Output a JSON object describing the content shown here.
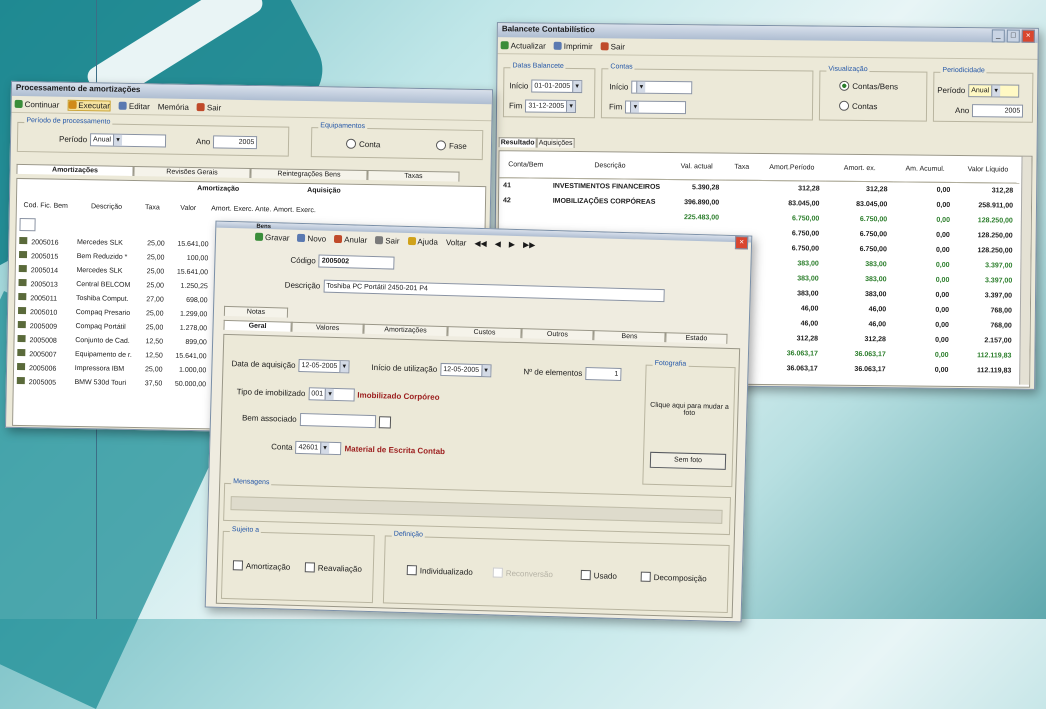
{
  "window_amortizations": {
    "title": "Processamento de amortizações",
    "toolbar": [
      "Continuar",
      "Executar",
      "Editar",
      "Memória",
      "Sair"
    ],
    "period_group": "Período de processamento",
    "period_label": "Período",
    "period_value": "Anual",
    "year_label": "Ano",
    "year_value": "2005",
    "equipment_group": "Equipamentos",
    "radio1": "Conta",
    "radio2": "Fase",
    "tabs": [
      "Amortizações",
      "Revisões Gerais",
      "Reintegrações Bens",
      "Taxas"
    ],
    "group_headers": [
      "Amortização",
      "Aquisição"
    ],
    "columns": [
      "Cod. Fic. Bem",
      "Descrição",
      "Taxa",
      "Valor",
      "Amort. Exerc. Ante.",
      "Amort. Exerc."
    ],
    "rows": [
      [
        "2005016",
        "Mercedes SLK",
        "25,00",
        "15.641,00",
        "3.910"
      ],
      [
        "2005015",
        "Bem Reduzido *",
        "25,00",
        "100,00",
        ""
      ],
      [
        "2005014",
        "Mercedes SLK",
        "25,00",
        "15.641,00",
        "3.9"
      ],
      [
        "2005013",
        "Central BELCOM",
        "25,00",
        "1.250,25",
        ""
      ],
      [
        "2005011",
        "Toshiba Comput.",
        "27,00",
        "698,00",
        ""
      ],
      [
        "2005010",
        "Compaq Presario",
        "25,00",
        "1.299,00",
        ""
      ],
      [
        "2005009",
        "Compaq Portátil",
        "25,00",
        "1.278,00",
        ""
      ],
      [
        "2005008",
        "Conjunto de Cad.",
        "12,50",
        "899,00",
        ""
      ],
      [
        "2005007",
        "Equipamento de r.",
        "12,50",
        "15.641,00",
        ""
      ],
      [
        "2005006",
        "Impressora IBM",
        "25,00",
        "1.000,00",
        ""
      ],
      [
        "2005005",
        "BMW 530d Touri",
        "37,50",
        "50.000,00",
        ""
      ]
    ]
  },
  "window_accounting": {
    "title": "Balancete Contabilístico",
    "toolbar": [
      "Actualizar",
      "Imprimir",
      "Sair"
    ],
    "dates_group": "Datas Balancete",
    "from_label": "Início",
    "from_value": "01-01-2005",
    "to_label": "Fim",
    "to_value": "31-12-2005",
    "accounts_group": "Contas",
    "acc_from_label": "Início",
    "acc_to_label": "Fim",
    "view_group": "Visualização",
    "radio_accounts_assets": "Contas/Bens",
    "radio_accounts": "Contas",
    "period_group": "Periodicidade",
    "period_label": "Período",
    "period_value": "Anual",
    "year_label": "Ano",
    "year_value": "2005",
    "tabs": [
      "Resultado",
      "Aquisições"
    ],
    "columns": [
      "Conta/Bem",
      "Descrição",
      "Val. actual",
      "Taxa",
      "Amort.Período",
      "Amort. ex.",
      "Am. Acumul.",
      "Valor Líquido"
    ],
    "rows": [
      {
        "conta": "41",
        "descricao": "INVESTIMENTOS FINANCEIROS",
        "val": "5.390,28",
        "taxa": "",
        "ap": "312,28",
        "ae": "312,28",
        "aa": "0,00",
        "vl": "312,28",
        "green": false
      },
      {
        "conta": "42",
        "descricao": "IMOBILIZAÇÕES CORPÓREAS",
        "val": "396.890,00",
        "taxa": "",
        "ap": "83.045,00",
        "ae": "83.045,00",
        "aa": "0,00",
        "vl": "258.911,00",
        "green": false
      },
      {
        "conta": "",
        "descricao": "",
        "val": "225.483,00",
        "taxa": "",
        "ap": "6.750,00",
        "ae": "6.750,00",
        "aa": "0,00",
        "vl": "128.250,00",
        "green": true
      },
      {
        "conta": "",
        "descricao": "",
        "val": "",
        "taxa": "",
        "ap": "6.750,00",
        "ae": "6.750,00",
        "aa": "0,00",
        "vl": "128.250,00",
        "green": false
      },
      {
        "conta": "",
        "descricao": "",
        "val": "",
        "taxa": "6,00",
        "ap": "6.750,00",
        "ae": "6.750,00",
        "aa": "0,00",
        "vl": "128.250,00",
        "green": false
      },
      {
        "conta": "",
        "descricao": "",
        "val": "",
        "taxa": "",
        "ap": "383,00",
        "ae": "383,00",
        "aa": "0,00",
        "vl": "3.397,00",
        "green": true
      },
      {
        "conta": "",
        "descricao": "",
        "val": "",
        "taxa": "",
        "ap": "383,00",
        "ae": "383,00",
        "aa": "0,00",
        "vl": "3.397,00",
        "green": true
      },
      {
        "conta": "",
        "descricao": "",
        "val": "",
        "taxa": "",
        "ap": "383,00",
        "ae": "383,00",
        "aa": "0,00",
        "vl": "3.397,00",
        "green": false
      },
      {
        "conta": "",
        "descricao": "",
        "val": "",
        "taxa": "",
        "ap": "46,00",
        "ae": "46,00",
        "aa": "0,00",
        "vl": "768,00",
        "green": false
      },
      {
        "conta": "",
        "descricao": "",
        "val": "",
        "taxa": "",
        "ap": "46,00",
        "ae": "46,00",
        "aa": "0,00",
        "vl": "768,00",
        "green": false
      },
      {
        "conta": "",
        "descricao": "",
        "val": "",
        "taxa": "",
        "ap": "312,28",
        "ae": "312,28",
        "aa": "0,00",
        "vl": "2.157,00",
        "green": false
      },
      {
        "conta": "",
        "descricao": "",
        "val": "",
        "taxa": "",
        "ap": "36.063,17",
        "ae": "36.063,17",
        "aa": "0,00",
        "vl": "112.119,83",
        "green": true
      },
      {
        "conta": "",
        "descricao": "",
        "val": "",
        "taxa": "",
        "ap": "36.063,17",
        "ae": "36.063,17",
        "aa": "0,00",
        "vl": "112.119,83",
        "green": false
      }
    ]
  },
  "window_asset": {
    "title": "Bens",
    "toolbar": [
      "Gravar",
      "Novo",
      "Anular",
      "Sair",
      "Ajuda",
      "Voltar"
    ],
    "code_label": "Código",
    "code_value": "2005002",
    "desc_label": "Descrição",
    "desc_value": "Toshiba PC Portátil 2450-201 P4",
    "tab_top": "Notas",
    "tabs": [
      "Geral",
      "Valores",
      "Amortizações",
      "Custos",
      "Outros",
      "Bens",
      "Estado"
    ],
    "acq_date_label": "Data de aquisição",
    "acq_date_value": "12-05-2005",
    "use_date_label": "Início de utilização",
    "use_date_value": "12-05-2005",
    "elements_label": "Nº de elementos",
    "elements_value": "1",
    "type_label": "Tipo de imobilizado",
    "type_code": "001",
    "type_desc": "Imobilizado Corpóreo",
    "assoc_label": "Bem associado",
    "account_label": "Conta",
    "account_code": "42601",
    "account_desc": "Material de Escrita Contab",
    "photo_group": "Fotografia",
    "photo_hint": "Clique aqui para mudar a foto",
    "photo_button": "Sem foto",
    "messages_group": "Mensagens",
    "sub_group": "Sujeito a",
    "chk_amort": "Amortização",
    "chk_reval": "Reavaliação",
    "def_group": "Definição",
    "chk_indiv": "Individualizado",
    "chk_disabled": "Reconversão",
    "chk_usado": "Usado",
    "chk_decomp": "Decomposição"
  }
}
